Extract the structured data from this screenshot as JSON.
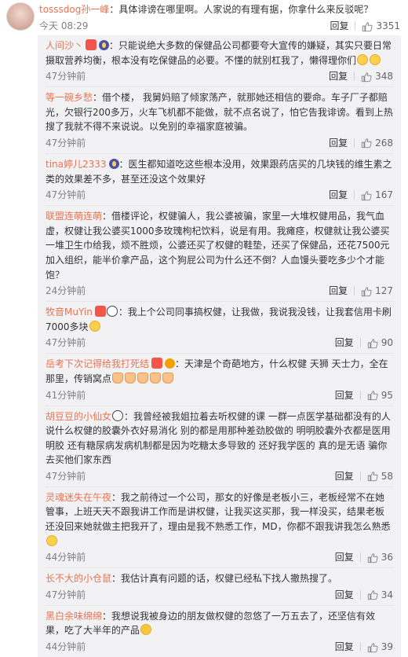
{
  "post": {
    "username": "tosssdog孙一峰",
    "text": "：具体诽谤在哪里啊。人家说的有理有据，你拿什么来反驳呢？",
    "time": "今天 08:29",
    "like_count": "3351"
  },
  "reply_label": "回复",
  "replies": [
    {
      "user": "人间沙丶",
      "text": "：只能说绝大多数的保健品公司都要夸大宣传的嫌疑，其实只要日常摄取营养均衡，根本没有吃保健品的必要。不懂的就别杠我了，懒得理你们",
      "time": "47分钟前",
      "likes": "348"
    },
    {
      "user": "等一碗乡愁",
      "text": "：借个楼， 我舅妈赔了倾家荡产，就那她还相信的要命。车子厂子都赔光，欠银行200多万，火车飞机都不能做，就不点名说了，怕它告我诽谤。看到上热搜了我就不得不来说说。以免别的幸福家庭被骗。",
      "time": "47分钟前",
      "likes": "268"
    },
    {
      "user": "tina婷儿2333",
      "text": "：医生都知道吃这些根本没用，效果跟药店买的几块钱的维生素之类的效果差不多，甚至还没这个效果好",
      "time": "47分钟前",
      "likes": "167"
    },
    {
      "user": "联盟连萌连萌",
      "text": "：借楼评论，权健骗人，我公婆被骗，家里一大堆权健用品，我气血虚，权健让我公婆买1000多玫瑰枸杞饮料，说是有用。我瘫痉，权健就让我公婆买一堆卫生巾给我，烦不胜烦，公婆还买了权健的鞋垫，还买了保健品，还花7500元加入组织，能半价拿产品，这个狗屁公司为什么还不倒？人血馒头要吃多少个才能饱？",
      "time": "24分钟前",
      "likes": "127"
    },
    {
      "user": "牧音MuYin",
      "text": "：我上个公司同事搞权健，让我做，我说我没钱，让我套信用卡刷7000多块",
      "time": "47分钟前",
      "likes": "90"
    },
    {
      "user": "岳考下次记得给我打死结",
      "text": "：天津是个奇葩地方，什么权健 天狮  天士力，全在那里，传销窝点",
      "time": "41分钟前",
      "likes": "95"
    },
    {
      "user": "胡豆豆的小仙女",
      "text": "：我曾经被我姐拉着去听权健的课 一群一点医学基础都没有的人说什么权健的胶囊外衣好易消化 别的都是用那种差劲胶做的 明明胶囊外衣都是医用明胶 还有糖尿病发病机制都是因为吃糖太多导致的 还好我学医的 真的是无语 骗你去买他们家东西",
      "time": "47分钟前",
      "likes": "58"
    },
    {
      "user": "灵魂迷失在午夜",
      "text": "：我之前待过一个公司，那女的好像是老板小三，老板经常不在她管事，上班天天不跟我讲工作而是讲权健，让我买这买那，我一样没买，结果老板还没回来她就做主把我开了，理由是我不熟悉工作，MD，你都不跟我讲我怎么熟悉",
      "time": "44分钟前",
      "likes": "36"
    },
    {
      "user": "长不大的小仓鼠",
      "text": "：我估计真有问题的话，权健已经私下找人撤热搜了。",
      "time": "47分钟前",
      "likes": "34"
    },
    {
      "user": "黑白余味绵绵",
      "text": "：我想说我被身边的朋友做权健的忽悠了一万五去了，还坚信有效果，吃了大半年的产品",
      "time": "44分钟前",
      "likes": "39"
    }
  ],
  "colors": {
    "username": "#eb7350",
    "reply_bg": "#f2f2f5",
    "meta": "#808080"
  },
  "icons": {
    "like": "thumbs-up-icon",
    "vip": "vip-badge-icon"
  }
}
